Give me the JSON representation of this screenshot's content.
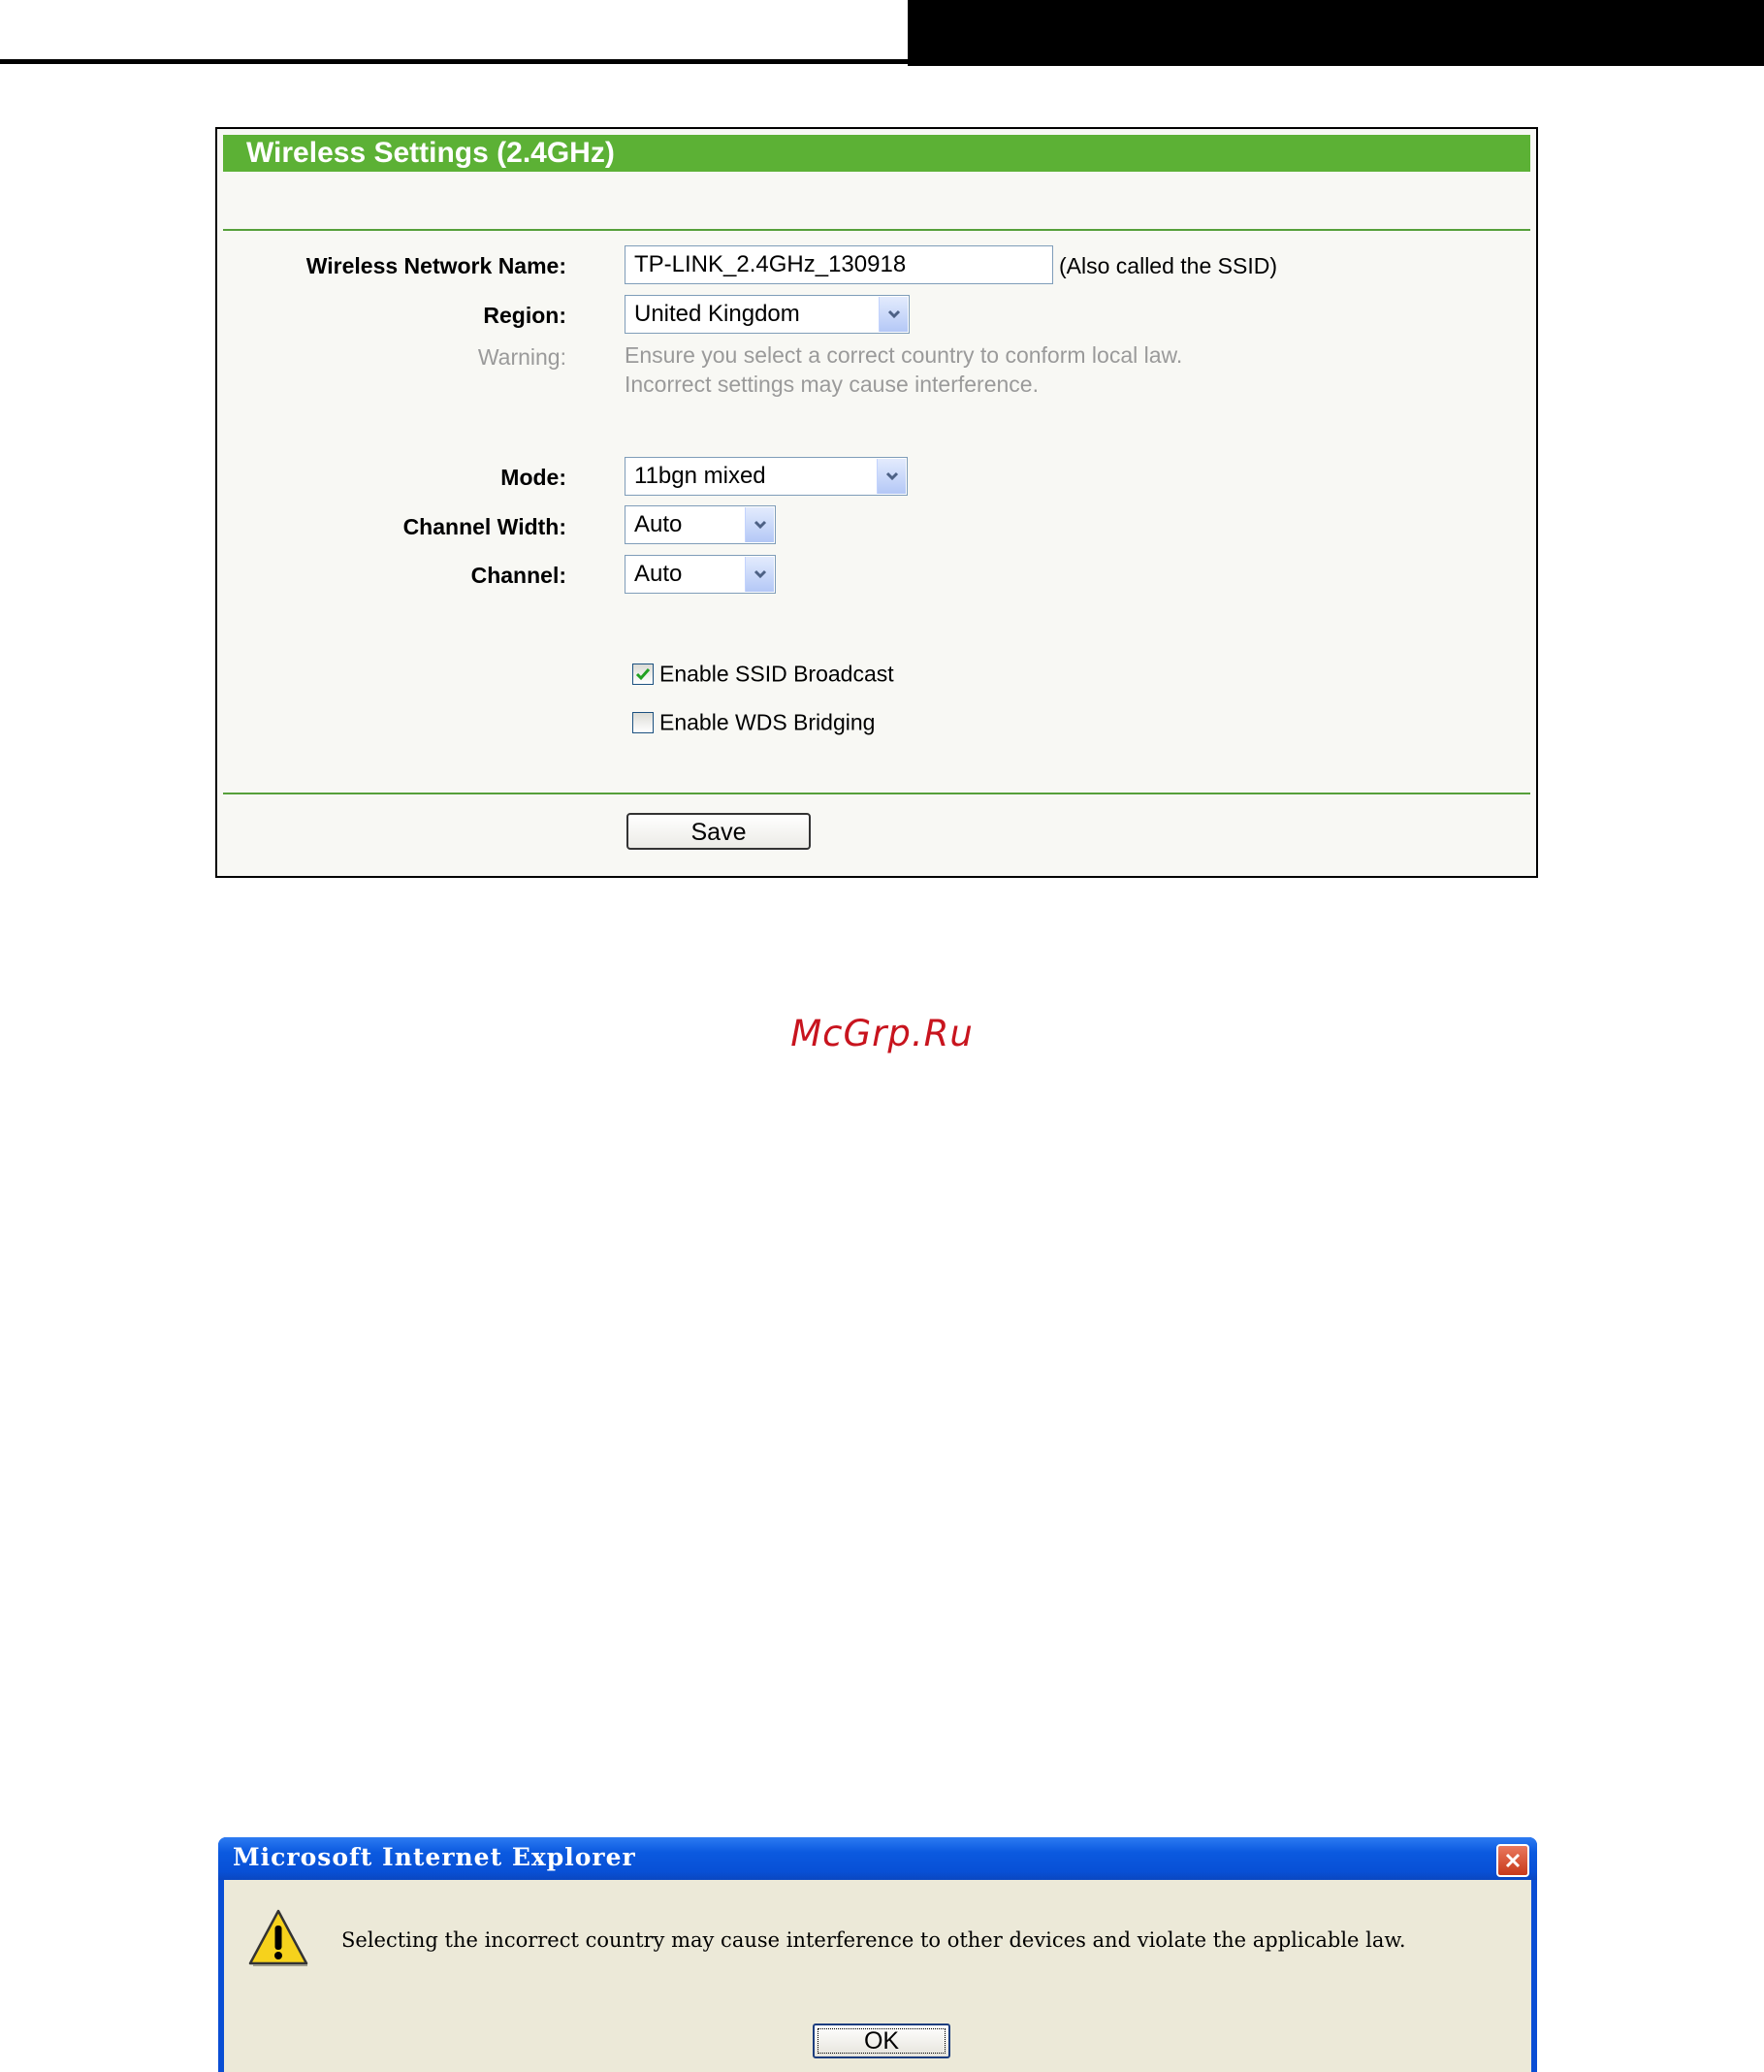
{
  "panel": {
    "title": "Wireless Settings (2.4GHz)",
    "network_name": {
      "label": "Wireless Network Name:",
      "value": "TP-LINK_2.4GHz_130918",
      "hint": "(Also called the SSID)"
    },
    "region": {
      "label": "Region:",
      "value": "United Kingdom"
    },
    "warning": {
      "label": "Warning:",
      "line1": "Ensure you select a correct country to conform local law.",
      "line2": "Incorrect settings may cause interference."
    },
    "mode": {
      "label": "Mode:",
      "value": "11bgn mixed"
    },
    "channel_width": {
      "label": "Channel Width:",
      "value": "Auto"
    },
    "channel": {
      "label": "Channel:",
      "value": "Auto"
    },
    "ssid_broadcast": {
      "label": "Enable SSID Broadcast",
      "checked": true
    },
    "wds_bridging": {
      "label": "Enable WDS Bridging",
      "checked": false
    },
    "save_label": "Save"
  },
  "watermark": "McGrp.Ru",
  "dialog": {
    "title": "Microsoft Internet Explorer",
    "message": "Selecting the incorrect country may cause interference to other devices and violate the applicable law.",
    "ok_label": "OK"
  },
  "colors": {
    "header_green": "#5cb135",
    "divider_green": "#56a03a",
    "warning_gray": "#9a9a9a",
    "xp_title_blue": "#0a4ed4",
    "dialog_face": "#ece9d8"
  }
}
